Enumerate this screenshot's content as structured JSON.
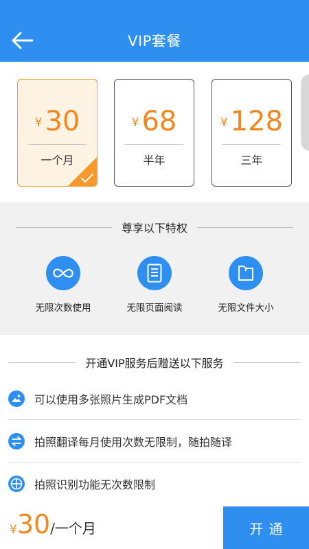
{
  "colors": {
    "accent": "#2f8ff0",
    "price": "#f2861f",
    "selected_border": "#f49a2b",
    "selected_bg": "#fff3e3",
    "section_bg": "#f1f1f1"
  },
  "header": {
    "title": "VIP套餐",
    "back_icon": "arrow-left-icon"
  },
  "plans": [
    {
      "currency": "¥",
      "price": "30",
      "period": "一个月",
      "selected": true
    },
    {
      "currency": "¥",
      "price": "68",
      "period": "半年",
      "selected": false
    },
    {
      "currency": "¥",
      "price": "128",
      "period": "三年",
      "selected": false
    }
  ],
  "privileges": {
    "title": "尊享以下特权",
    "items": [
      {
        "label": "无限次数使用",
        "icon": "infinity-icon"
      },
      {
        "label": "无限页面阅读",
        "icon": "document-icon"
      },
      {
        "label": "无限文件大小",
        "icon": "file-icon"
      }
    ]
  },
  "gifts": {
    "title": "开通VIP服务后赠送以下服务",
    "items": [
      {
        "text": "可以使用多张照片生成PDF文档",
        "icon": "photo-icon"
      },
      {
        "text": "拍照翻译每月使用次数无限制，随拍随译",
        "icon": "translate-arrows-icon"
      },
      {
        "text": "拍照识别功能无次数限制",
        "icon": "globe-icon"
      }
    ]
  },
  "footer": {
    "currency": "¥",
    "price": "30",
    "unit": "/一个月",
    "button_label": "开通"
  }
}
